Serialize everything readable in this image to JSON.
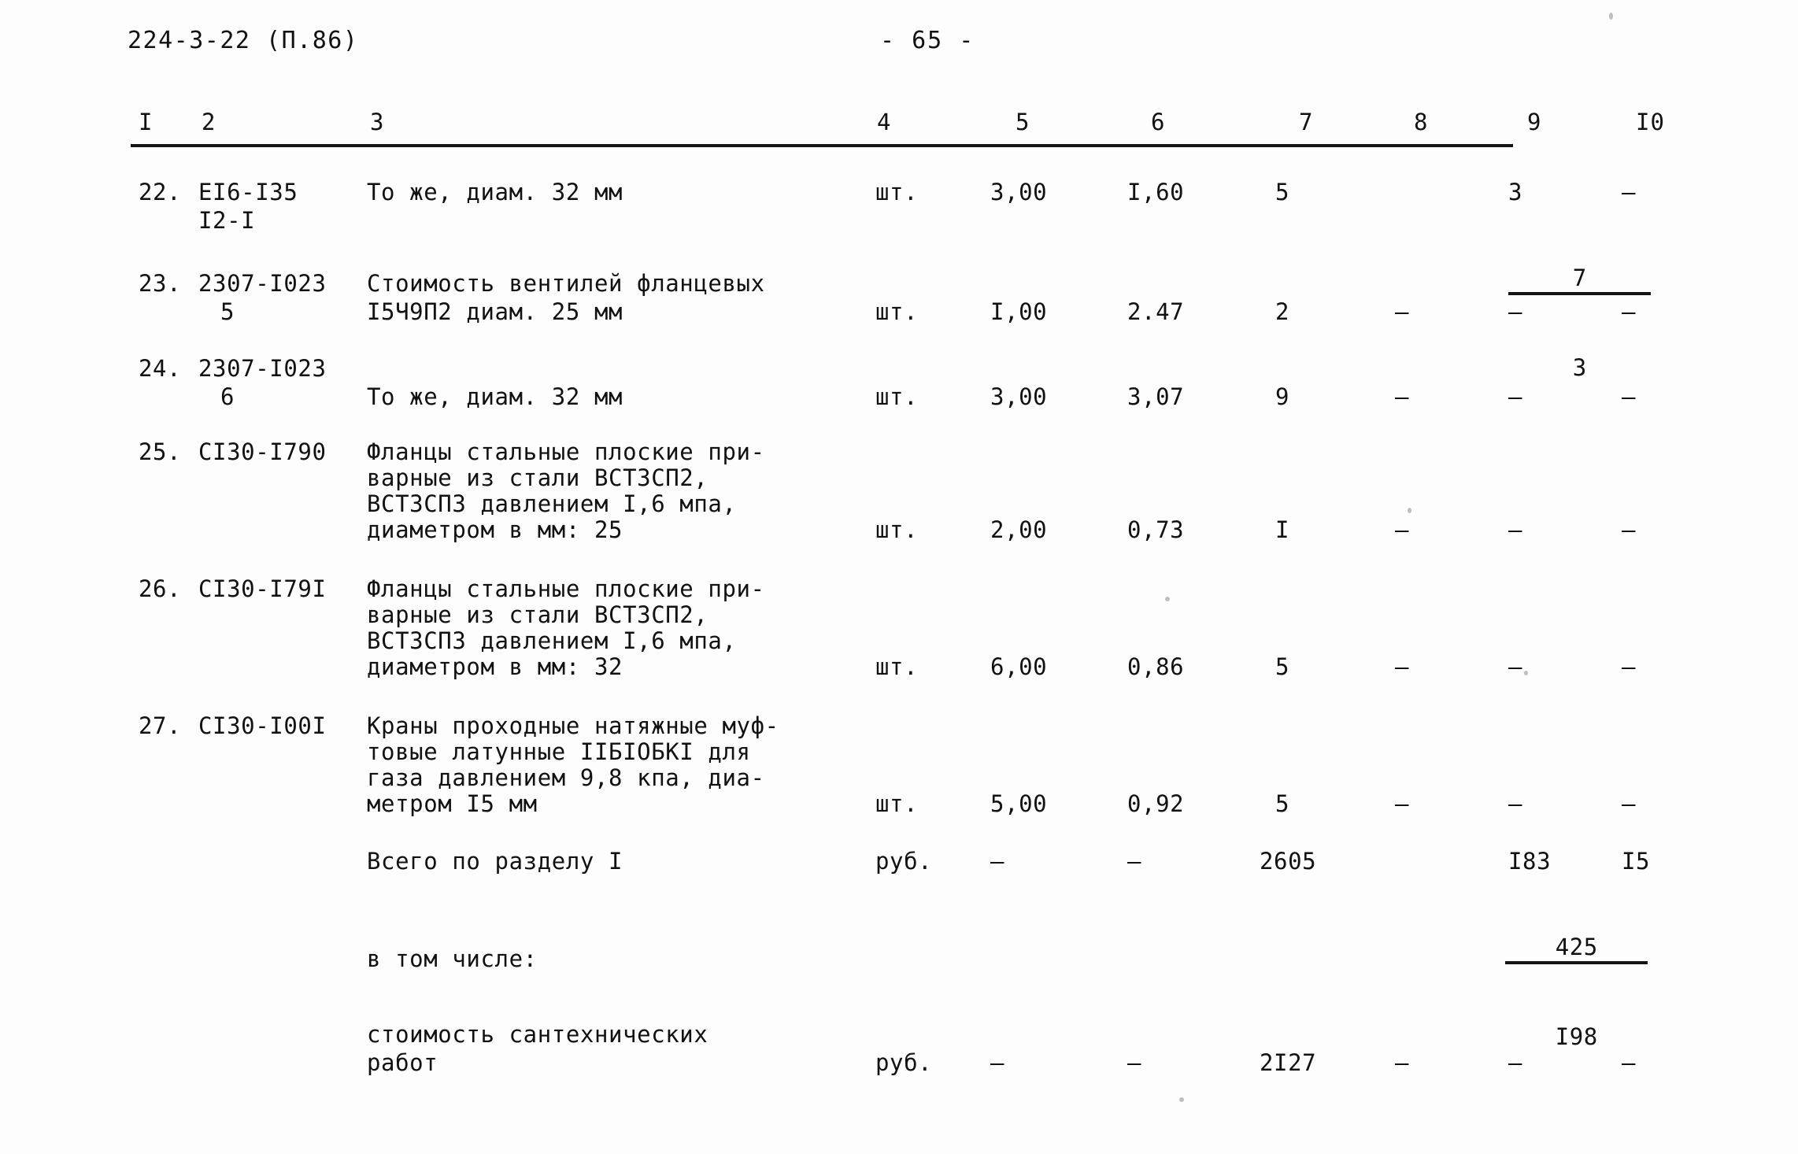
{
  "header": {
    "doc_code": "224-3-22 (П.86)",
    "page_number": "- 65 -"
  },
  "table": {
    "column_headers": [
      "I",
      "2",
      "3",
      "4",
      "5",
      "6",
      "7",
      "8",
      "9",
      "I0"
    ],
    "rows": [
      {
        "num": "22.",
        "code_line1": "EI6-I35",
        "code_line2": "I2-I",
        "desc": [
          "То же, диам. 32 мм"
        ],
        "unit": "шт.",
        "c5": "3,00",
        "c6": "I,60",
        "c7": "5",
        "c8_num": "7",
        "c8_den": "3",
        "c9": "3",
        "c10": "–"
      },
      {
        "num": "23.",
        "code_line1": "2307-I023",
        "code_line2": "5",
        "desc": [
          "Стоимость вентилей фланцевых",
          "I5Ч9П2 диам. 25 мм"
        ],
        "unit": "шт.",
        "c5": "I,00",
        "c6": "2.47",
        "c7": "2",
        "c8": "–",
        "c9": "–",
        "c10": "–"
      },
      {
        "num": "24.",
        "code_line1": "2307-I023",
        "code_line2": "6",
        "desc": [
          "То же, диам. 32 мм"
        ],
        "unit": "шт.",
        "c5": "3,00",
        "c6": "3,07",
        "c7": "9",
        "c8": "–",
        "c9": "–",
        "c10": "–"
      },
      {
        "num": "25.",
        "code_line1": "СI30-I790",
        "code_line2": "",
        "desc": [
          "Фланцы стальные плоские при-",
          "варные из стали ВСТ3СП2,",
          "ВСТ3СП3 давлением I,6 мпа,",
          "диаметром в мм: 25"
        ],
        "unit": "шт.",
        "c5": "2,00",
        "c6": "0,73",
        "c7": "I",
        "c8": "–",
        "c9": "–",
        "c10": "–"
      },
      {
        "num": "26.",
        "code_line1": "СI30-I79I",
        "code_line2": "",
        "desc": [
          "Фланцы стальные плоские при-",
          "варные из стали ВСТ3СП2,",
          "ВСТ3СП3 давлением I,6 мпа,",
          "диаметром в мм: 32"
        ],
        "unit": "шт.",
        "c5": "6,00",
        "c6": "0,86",
        "c7": "5",
        "c8": "–",
        "c9": "–",
        "c10": "–"
      },
      {
        "num": "27.",
        "code_line1": "СI30-I00I",
        "code_line2": "",
        "desc": [
          "Краны проходные натяжные муф-",
          "товые латунные IIБIОБКI для",
          "газа давлением 9,8 кпа, диа-",
          "метром I5 мм"
        ],
        "unit": "шт.",
        "c5": "5,00",
        "c6": "0,92",
        "c7": "5",
        "c8": "–",
        "c9": "–",
        "c10": "–"
      }
    ],
    "total_row": {
      "desc": "Всего по разделу I",
      "unit": "руб.",
      "c5": "–",
      "c6": "–",
      "c7": "2605",
      "c8_num": "425",
      "c8_den": "I98",
      "c9": "I83",
      "c10": "I5"
    },
    "including_label": "в том числе:",
    "subtotal_row": {
      "desc_line1": "стоимость сантехнических",
      "desc_line2": "работ",
      "unit": "руб.",
      "c5": "–",
      "c6": "–",
      "c7": "2I27",
      "c8": "–",
      "c9": "–",
      "c10": "–"
    }
  }
}
